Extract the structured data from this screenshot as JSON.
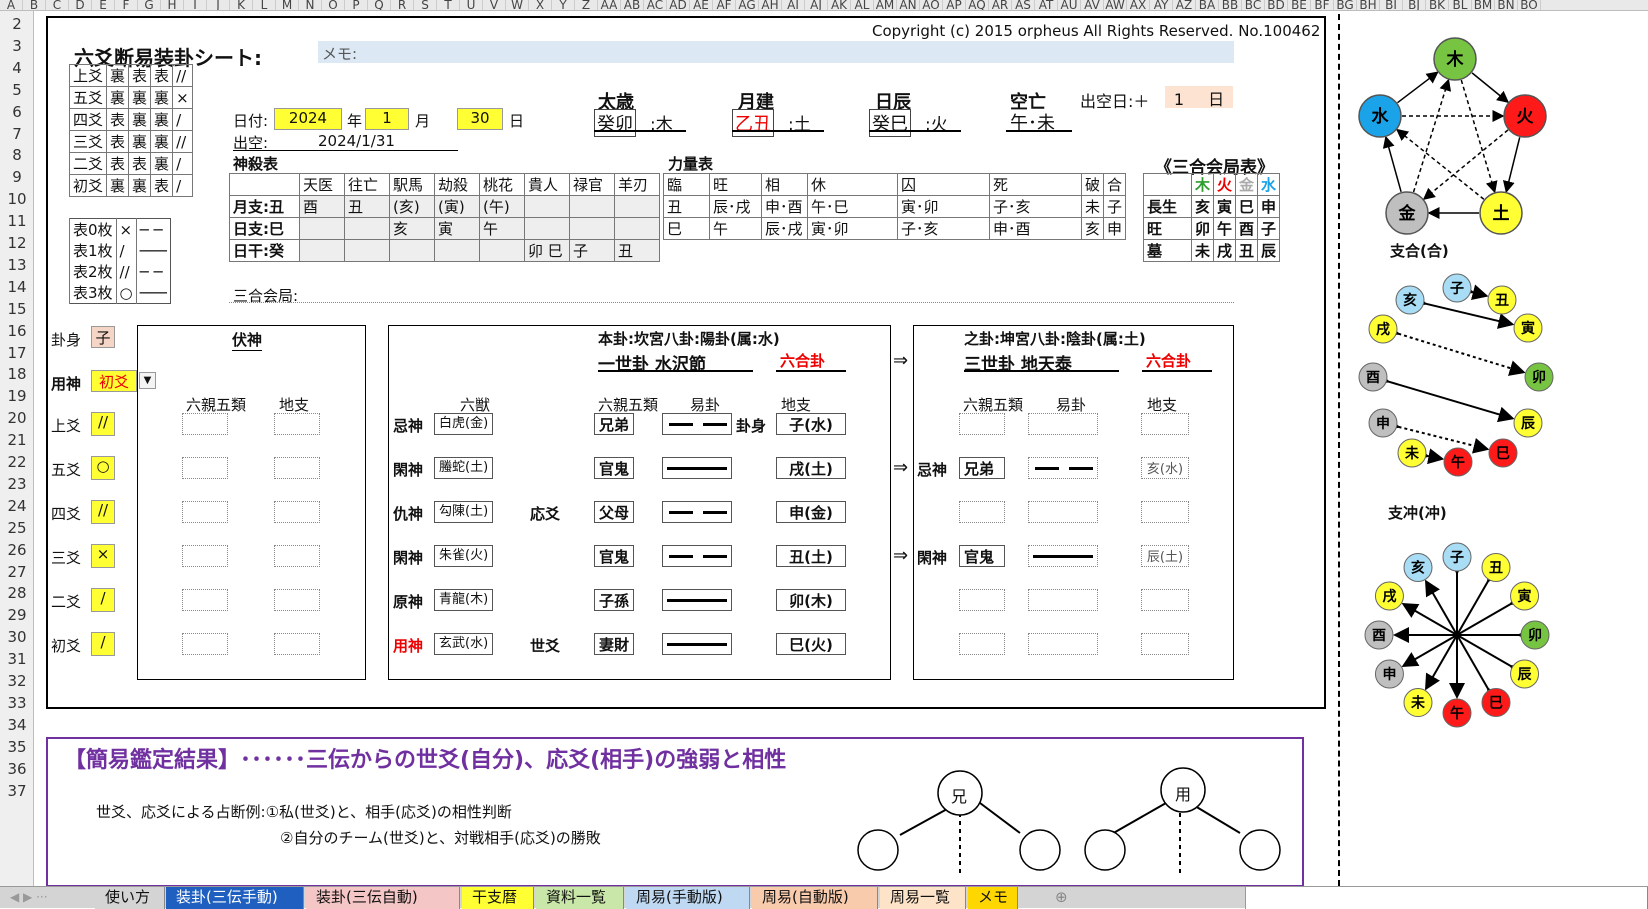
{
  "col_headers": [
    "A",
    "B",
    "C",
    "D",
    "E",
    "F",
    "G",
    "H",
    "I",
    "J",
    "K",
    "L",
    "M",
    "N",
    "O",
    "P",
    "Q",
    "R",
    "S",
    "T",
    "U",
    "V",
    "W",
    "X",
    "Y",
    "Z",
    "AA",
    "AB",
    "AC",
    "AD",
    "AE",
    "AF",
    "AG",
    "AH",
    "AI",
    "AJ",
    "AK",
    "AL",
    "AM",
    "AN",
    "AO",
    "AP",
    "AQ",
    "AR",
    "AS",
    "AT",
    "AU",
    "AV",
    "AW",
    "AX",
    "AY",
    "AZ",
    "BA",
    "BB",
    "BC",
    "BD",
    "BE",
    "BF",
    "BG",
    "BH",
    "BI",
    "BJ",
    "BK",
    "BL",
    "BM",
    "BN",
    "BO"
  ],
  "row_numbers": [
    "2",
    "3",
    "4",
    "5",
    "6",
    "7",
    "8",
    "9",
    "10",
    "11",
    "12",
    "13",
    "14",
    "15",
    "16",
    "17",
    "18",
    "19",
    "20",
    "21",
    "22",
    "23",
    "24",
    "25",
    "26",
    "27",
    "28",
    "29",
    "30",
    "31",
    "32",
    "33",
    "34",
    "35",
    "36",
    "37"
  ],
  "sheet": {
    "copyright": "Copyright (c) 2015 orpheus All Rights Reserved.  No.100462",
    "title": "六爻断易装卦シート:",
    "memo_label": "メモ:",
    "yao_legend": [
      [
        "上爻",
        "裏",
        "表",
        "表",
        "//"
      ],
      [
        "五爻",
        "裏",
        "裏",
        "裏",
        "×"
      ],
      [
        "四爻",
        "表",
        "裏",
        "裏",
        "/"
      ],
      [
        "三爻",
        "表",
        "裏",
        "裏",
        "//"
      ],
      [
        "二爻",
        "表",
        "表",
        "裏",
        "/"
      ],
      [
        "初爻",
        "裏",
        "裏",
        "表",
        "/"
      ]
    ],
    "coin_legend": [
      [
        "表0枚",
        "×",
        "─ ─"
      ],
      [
        "表1枚",
        "/",
        "───"
      ],
      [
        "表2枚",
        "//",
        "─ ─"
      ],
      [
        "表3枚",
        "○",
        "───"
      ]
    ],
    "date": {
      "label": "日付:",
      "year": "2024",
      "year_unit": "年",
      "month": "1",
      "month_unit": "月",
      "day": "30",
      "day_unit": "日"
    },
    "chukuu": {
      "label": "出空:",
      "value": "2024/1/31"
    },
    "taisai": {
      "label": "太歳",
      "value": "癸卯",
      "elem": ":木"
    },
    "gekken": {
      "label": "月建",
      "value": "乙丑",
      "elem": ":土"
    },
    "nissin": {
      "label": "日辰",
      "value": "癸巳",
      "elem": ":火"
    },
    "kuubou": {
      "label": "空亡",
      "value": "午･未"
    },
    "chukuubi": {
      "label": "出空日:＋",
      "value": "1",
      "unit": "日"
    },
    "shinsatsu": {
      "title": "神殺表",
      "headers": [
        "天医",
        "往亡",
        "駅馬",
        "劫殺",
        "桃花",
        "貴人",
        "禄官",
        "羊刃"
      ],
      "rows": [
        {
          "label": "月支:丑",
          "cells": [
            "酉",
            "丑",
            "(亥)",
            "(寅)",
            "(午)",
            "",
            "",
            ""
          ]
        },
        {
          "label": "日支:巳",
          "cells": [
            "",
            "",
            "亥",
            "寅",
            "午",
            "",
            "",
            ""
          ]
        },
        {
          "label": "日干:癸",
          "cells": [
            "",
            "",
            "",
            "",
            "",
            "卯 巳",
            "子",
            "丑"
          ]
        }
      ]
    },
    "rikiryo": {
      "title": "力量表",
      "headers": [
        "臨",
        "旺",
        "相",
        "休",
        "囚",
        "死",
        "破",
        "合"
      ],
      "rows": [
        [
          "丑",
          "辰･戌",
          "申･酉",
          "午･巳",
          "寅･卯",
          "子･亥",
          "未",
          "子"
        ],
        [
          "巳",
          "午",
          "辰･戌",
          "寅･卯",
          "子･亥",
          "申･酉",
          "亥",
          "申"
        ]
      ]
    },
    "sangou": {
      "title": "《三合会局表》",
      "headers": [
        "木",
        "火",
        "金",
        "水"
      ],
      "rows": [
        {
          "label": "長生",
          "cells": [
            "亥",
            "寅",
            "巳",
            "申"
          ]
        },
        {
          "label": "旺",
          "cells": [
            "卯",
            "午",
            "酉",
            "子"
          ]
        },
        {
          "label": "墓",
          "cells": [
            "未",
            "戌",
            "丑",
            "辰"
          ]
        }
      ]
    },
    "sangou_kai": "三合会局:",
    "kashin_label": "卦身",
    "kashin_value": "子",
    "youjin_label": "用神",
    "youjin_value": "初爻",
    "yao_rows": [
      {
        "label": "上爻",
        "mark": "//"
      },
      {
        "label": "五爻",
        "mark": "○"
      },
      {
        "label": "四爻",
        "mark": "//"
      },
      {
        "label": "三爻",
        "mark": "×"
      },
      {
        "label": "二爻",
        "mark": "/"
      },
      {
        "label": "初爻",
        "mark": "/"
      }
    ],
    "fukushin": {
      "title": "伏神",
      "h1": "六親五類",
      "h2": "地支"
    },
    "honka": {
      "title": "本卦:坎宮八卦:陽卦(属:水)",
      "sub": "一世卦  水沢節",
      "rokugou": "六合卦",
      "h_roku": "六獣",
      "h_six": "六親五類",
      "h_eki": "易卦",
      "h_chi": "地支",
      "rows": [
        {
          "role": "忌神",
          "beast": "白虎(金)",
          "pos": "",
          "six": "兄弟",
          "yin": true,
          "kashin": "卦身",
          "chi": "子(水)"
        },
        {
          "role": "閑神",
          "beast": "螣蛇(土)",
          "pos": "",
          "six": "官鬼",
          "yin": false,
          "kashin": "",
          "chi": "戌(土)"
        },
        {
          "role": "仇神",
          "beast": "勾陳(土)",
          "pos": "応爻",
          "six": "父母",
          "yin": true,
          "kashin": "",
          "chi": "申(金)"
        },
        {
          "role": "閑神",
          "beast": "朱雀(火)",
          "pos": "",
          "six": "官鬼",
          "yin": true,
          "kashin": "",
          "chi": "丑(土)"
        },
        {
          "role": "原神",
          "beast": "青龍(木)",
          "pos": "",
          "six": "子孫",
          "yin": false,
          "kashin": "",
          "chi": "卯(木)"
        },
        {
          "role": "用神",
          "beast": "玄武(水)",
          "pos": "世爻",
          "six": "妻財",
          "yin": false,
          "kashin": "",
          "chi": "巳(火)"
        }
      ]
    },
    "arrow": "⇒",
    "yuka": {
      "title": "之卦:坤宮八卦:陰卦(属:土)",
      "sub": "三世卦  地天泰",
      "rokugou": "六合卦",
      "h_six": "六親五類",
      "h_eki": "易卦",
      "h_chi": "地支",
      "rows": [
        {
          "role": "",
          "six": "",
          "yin": null,
          "chi": ""
        },
        {
          "role": "忌神",
          "six": "兄弟",
          "yin": true,
          "chi": "亥(水)"
        },
        {
          "role": "",
          "six": "",
          "yin": null,
          "chi": ""
        },
        {
          "role": "閑神",
          "six": "官鬼",
          "yin": false,
          "chi": "辰(土)"
        },
        {
          "role": "",
          "six": "",
          "yin": null,
          "chi": ""
        },
        {
          "role": "",
          "six": "",
          "yin": null,
          "chi": ""
        }
      ]
    },
    "result": {
      "title": "【簡易鑑定結果】･･････三伝からの世爻(自分)、応爻(相手)の強弱と相性",
      "line1": "世爻、応爻による占断例:①私(世爻)と、相手(応爻)の相性判断",
      "line2": "②自分のチーム(世爻)と、対戦相手(応爻)の勝敗",
      "node1": "兄",
      "node2": "用"
    }
  },
  "diagrams": {
    "elements": {
      "wood": "木",
      "fire": "火",
      "earth": "土",
      "metal": "金",
      "water": "水"
    },
    "colors": {
      "wood": "#77c442",
      "fire": "#ff1a1a",
      "earth": "#ffff33",
      "metal": "#bfbfbf",
      "water": "#1aa3e8",
      "light_blue": "#a8ddf5"
    },
    "shigou_label": "支合(合)",
    "shichuu_label": "支冲(冲)",
    "branches": [
      "子",
      "丑",
      "寅",
      "卯",
      "辰",
      "巳",
      "午",
      "未",
      "申",
      "酉",
      "戌",
      "亥"
    ]
  },
  "tabs": [
    "使い方",
    "装卦(三伝手動)",
    "装卦(三伝自動)",
    "干支暦",
    "資料一覧",
    "周易(手動版)",
    "周易(自動版)",
    "周易一覧",
    "メモ"
  ]
}
